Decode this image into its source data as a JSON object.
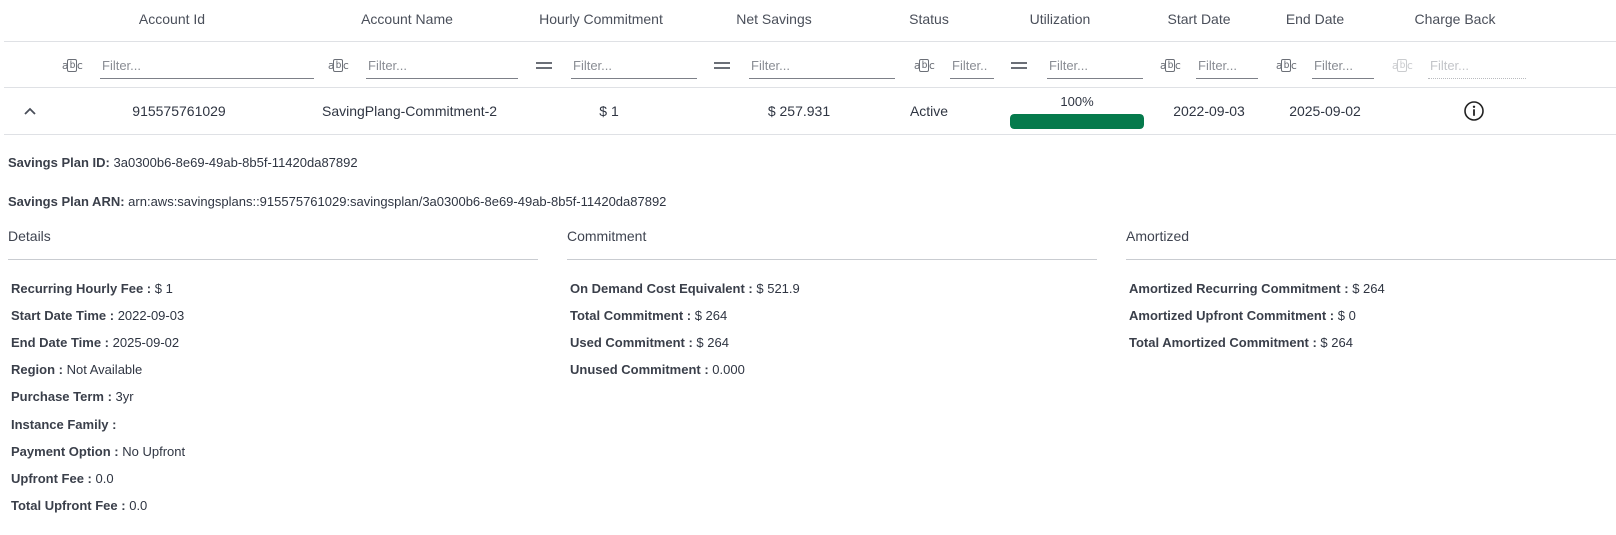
{
  "columns": {
    "account_id": "Account Id",
    "account_name": "Account Name",
    "hourly_commitment": "Hourly Commitment",
    "net_savings": "Net Savings",
    "status": "Status",
    "utilization": "Utilization",
    "start_date": "Start Date",
    "end_date": "End Date",
    "charge_back": "Charge Back"
  },
  "filters": {
    "placeholder": "Filter...",
    "status_placeholder": "Filter..",
    "text_icon": "abc",
    "number_icon": "equals-icon"
  },
  "row": {
    "account_id": "915575761029",
    "account_name": "SavingPlang-Commitment-2",
    "hourly_commitment": "$ 1",
    "net_savings": "$ 257.931",
    "status": "Active",
    "utilization_label": "100%",
    "utilization_value": 1.0,
    "start_date": "2022-09-03",
    "end_date": "2025-09-02"
  },
  "detail": {
    "plan_id_label": "Savings Plan ID:",
    "plan_id": "3a0300b6-8e69-49ab-8b5f-11420da87892",
    "plan_arn_label": "Savings Plan ARN:",
    "plan_arn": "arn:aws:savingsplans::915575761029:savingsplan/3a0300b6-8e69-49ab-8b5f-11420da87892",
    "details_title": "Details",
    "commitment_title": "Commitment",
    "amortized_title": "Amortized",
    "details": [
      {
        "label": "Recurring Hourly Fee :",
        "value": "$ 1"
      },
      {
        "label": "Start Date Time :",
        "value": "2022-09-03"
      },
      {
        "label": "End Date Time :",
        "value": "2025-09-02"
      },
      {
        "label": "Region :",
        "value": "Not Available"
      },
      {
        "label": "Purchase Term :",
        "value": "3yr"
      },
      {
        "label": "Instance Family :",
        "value": ""
      },
      {
        "label": "Payment Option :",
        "value": "No Upfront"
      },
      {
        "label": "Upfront Fee :",
        "value": "0.0"
      },
      {
        "label": "Total Upfront Fee :",
        "value": "0.0"
      }
    ],
    "commitment": [
      {
        "label": "On Demand Cost Equivalent :",
        "value": "$ 521.9"
      },
      {
        "label": "Total Commitment :",
        "value": "$ 264"
      },
      {
        "label": "Used Commitment :",
        "value": "$ 264"
      },
      {
        "label": "Unused Commitment :",
        "value": "0.000"
      }
    ],
    "amortized": [
      {
        "label": "Amortized Recurring Commitment :",
        "value": "$ 264"
      },
      {
        "label": "Amortized Upfront Commitment :",
        "value": "$ 0"
      },
      {
        "label": "Total Amortized Commitment :",
        "value": "$ 264"
      }
    ]
  },
  "colors": {
    "utilization_fill": "#057a4c",
    "border": "#dfe1e5"
  }
}
